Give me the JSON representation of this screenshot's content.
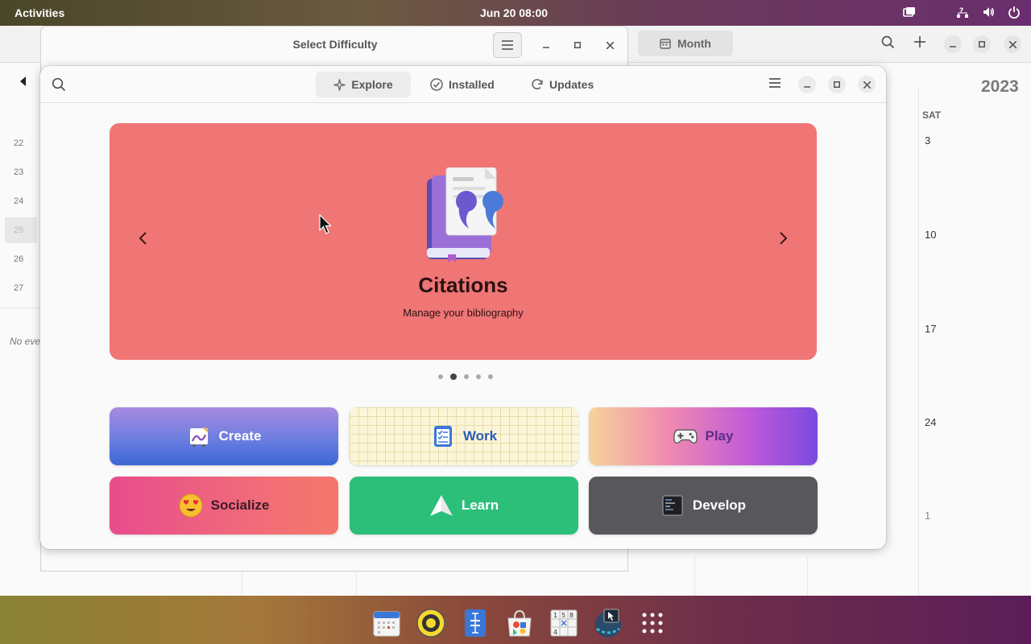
{
  "topbar": {
    "activities": "Activities",
    "clock": "Jun 20  08:00"
  },
  "calendar": {
    "view_button": "Month",
    "year": "2023",
    "weekday": "SAT",
    "days": [
      "3",
      "10",
      "17",
      "24",
      "1"
    ],
    "weeks": [
      "22",
      "23",
      "24",
      "25",
      "26",
      "27"
    ],
    "no_events": "No eve"
  },
  "sudoku": {
    "title": "Select Difficulty"
  },
  "software": {
    "tabs": [
      {
        "label": "Explore",
        "icon": "explore-icon"
      },
      {
        "label": "Installed",
        "icon": "check-icon"
      },
      {
        "label": "Updates",
        "icon": "refresh-icon"
      }
    ],
    "banner": {
      "title": "Citations",
      "subtitle": "Manage your bibliography",
      "color": "#f07575",
      "dots": 5,
      "active_dot": 2
    },
    "categories": [
      {
        "label": "Create",
        "icon": "paint-icon"
      },
      {
        "label": "Work",
        "icon": "checklist-icon"
      },
      {
        "label": "Play",
        "icon": "gamepad-icon"
      },
      {
        "label": "Socialize",
        "icon": "heart-eyes-icon"
      },
      {
        "label": "Learn",
        "icon": "paper-plane-icon"
      },
      {
        "label": "Develop",
        "icon": "terminal-icon"
      }
    ]
  },
  "dock": {
    "apps": [
      "calendar-icon",
      "rhythmbox-icon",
      "text-editor-icon",
      "software-icon",
      "sudoku-icon",
      "screenshot-icon",
      "app-grid-icon"
    ]
  }
}
